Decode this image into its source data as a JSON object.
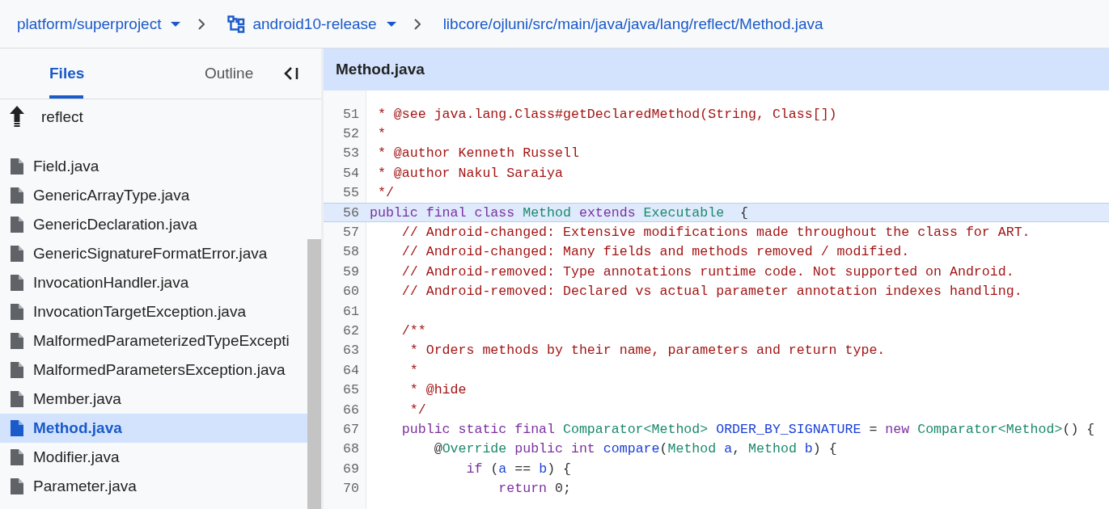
{
  "breadcrumb": {
    "project": "platform/superproject",
    "branch": "android10-release",
    "path": "libcore/ojluni/src/main/java/java/lang/reflect/Method.java"
  },
  "sidebar": {
    "tabs": [
      {
        "label": "Files",
        "selected": true
      },
      {
        "label": "Outline",
        "selected": false
      }
    ],
    "folder": "reflect",
    "files": [
      {
        "name": "Field.java",
        "selected": false
      },
      {
        "name": "GenericArrayType.java",
        "selected": false
      },
      {
        "name": "GenericDeclaration.java",
        "selected": false
      },
      {
        "name": "GenericSignatureFormatError.java",
        "selected": false
      },
      {
        "name": "InvocationHandler.java",
        "selected": false
      },
      {
        "name": "InvocationTargetException.java",
        "selected": false
      },
      {
        "name": "MalformedParameterizedTypeExcepti",
        "selected": false
      },
      {
        "name": "MalformedParametersException.java",
        "selected": false
      },
      {
        "name": "Member.java",
        "selected": false
      },
      {
        "name": "Method.java",
        "selected": true
      },
      {
        "name": "Modifier.java",
        "selected": false
      },
      {
        "name": "Parameter.java",
        "selected": false
      }
    ]
  },
  "editor": {
    "title": "Method.java",
    "lines": [
      {
        "number": "51",
        "selected": false,
        "tokens": [
          {
            "text": " * @see java.lang.Class#getDeclaredMethod(String, Class[])",
            "kind": "comment"
          }
        ]
      },
      {
        "number": "52",
        "selected": false,
        "tokens": [
          {
            "text": " *",
            "kind": "comment"
          }
        ]
      },
      {
        "number": "53",
        "selected": false,
        "tokens": [
          {
            "text": " * @author Kenneth Russell",
            "kind": "comment"
          }
        ]
      },
      {
        "number": "54",
        "selected": false,
        "tokens": [
          {
            "text": " * @author Nakul Saraiya",
            "kind": "comment"
          }
        ]
      },
      {
        "number": "55",
        "selected": false,
        "tokens": [
          {
            "text": " */",
            "kind": "comment"
          }
        ]
      },
      {
        "number": "56",
        "selected": true,
        "tokens": [
          {
            "text": "public final class ",
            "kind": "keyword"
          },
          {
            "text": "Method ",
            "kind": "type"
          },
          {
            "text": "extends ",
            "kind": "keyword"
          },
          {
            "text": "Executable",
            "kind": "type"
          },
          {
            "text": "  {",
            "kind": "plain"
          }
        ]
      },
      {
        "number": "57",
        "selected": false,
        "tokens": [
          {
            "text": "    // Android-changed: Extensive modifications made throughout the class for ART.",
            "kind": "comment"
          }
        ]
      },
      {
        "number": "58",
        "selected": false,
        "tokens": [
          {
            "text": "    // Android-changed: Many fields and methods removed / modified.",
            "kind": "comment"
          }
        ]
      },
      {
        "number": "59",
        "selected": false,
        "tokens": [
          {
            "text": "    // Android-removed: Type annotations runtime code. Not supported on Android.",
            "kind": "comment"
          }
        ]
      },
      {
        "number": "60",
        "selected": false,
        "tokens": [
          {
            "text": "    // Android-removed: Declared vs actual parameter annotation indexes handling.",
            "kind": "comment"
          }
        ]
      },
      {
        "number": "61",
        "selected": false
      },
      {
        "number": "62",
        "selected": false,
        "tokens": [
          {
            "text": "    /**",
            "kind": "comment"
          }
        ]
      },
      {
        "number": "63",
        "selected": false,
        "tokens": [
          {
            "text": "     * Orders methods by their name, parameters and return type.",
            "kind": "comment"
          }
        ]
      },
      {
        "number": "64",
        "selected": false,
        "tokens": [
          {
            "text": "     *",
            "kind": "comment"
          }
        ]
      },
      {
        "number": "65",
        "selected": false,
        "tokens": [
          {
            "text": "     * @hide",
            "kind": "comment"
          }
        ]
      },
      {
        "number": "66",
        "selected": false,
        "tokens": [
          {
            "text": "     */",
            "kind": "comment"
          }
        ]
      },
      {
        "number": "67",
        "selected": false,
        "tokens": [
          {
            "text": "    public static final ",
            "kind": "keyword"
          },
          {
            "text": "Comparator<Method> ",
            "kind": "type"
          },
          {
            "text": "ORDER_BY_SIGNATURE",
            "kind": "name"
          },
          {
            "text": " = ",
            "kind": "plain"
          },
          {
            "text": "new ",
            "kind": "keyword"
          },
          {
            "text": "Comparator<Method>",
            "kind": "type"
          },
          {
            "text": "() {",
            "kind": "plain"
          }
        ]
      },
      {
        "number": "68",
        "selected": false,
        "tokens": [
          {
            "text": "        @",
            "kind": "plain"
          },
          {
            "text": "Override ",
            "kind": "type"
          },
          {
            "text": "public int ",
            "kind": "keyword"
          },
          {
            "text": "compare",
            "kind": "name"
          },
          {
            "text": "(",
            "kind": "plain"
          },
          {
            "text": "Method ",
            "kind": "type"
          },
          {
            "text": "a",
            "kind": "name"
          },
          {
            "text": ", ",
            "kind": "plain"
          },
          {
            "text": "Method ",
            "kind": "type"
          },
          {
            "text": "b",
            "kind": "name"
          },
          {
            "text": ") {",
            "kind": "plain"
          }
        ]
      },
      {
        "number": "69",
        "selected": false,
        "tokens": [
          {
            "text": "            if",
            "kind": "keyword"
          },
          {
            "text": " (",
            "kind": "plain"
          },
          {
            "text": "a",
            "kind": "name"
          },
          {
            "text": " == ",
            "kind": "plain"
          },
          {
            "text": "b",
            "kind": "name"
          },
          {
            "text": ") {",
            "kind": "plain"
          }
        ]
      },
      {
        "number": "70",
        "selected": false,
        "tokens": [
          {
            "text": "                return",
            "kind": "keyword"
          },
          {
            "text": " 0;",
            "kind": "plain"
          }
        ]
      }
    ]
  }
}
